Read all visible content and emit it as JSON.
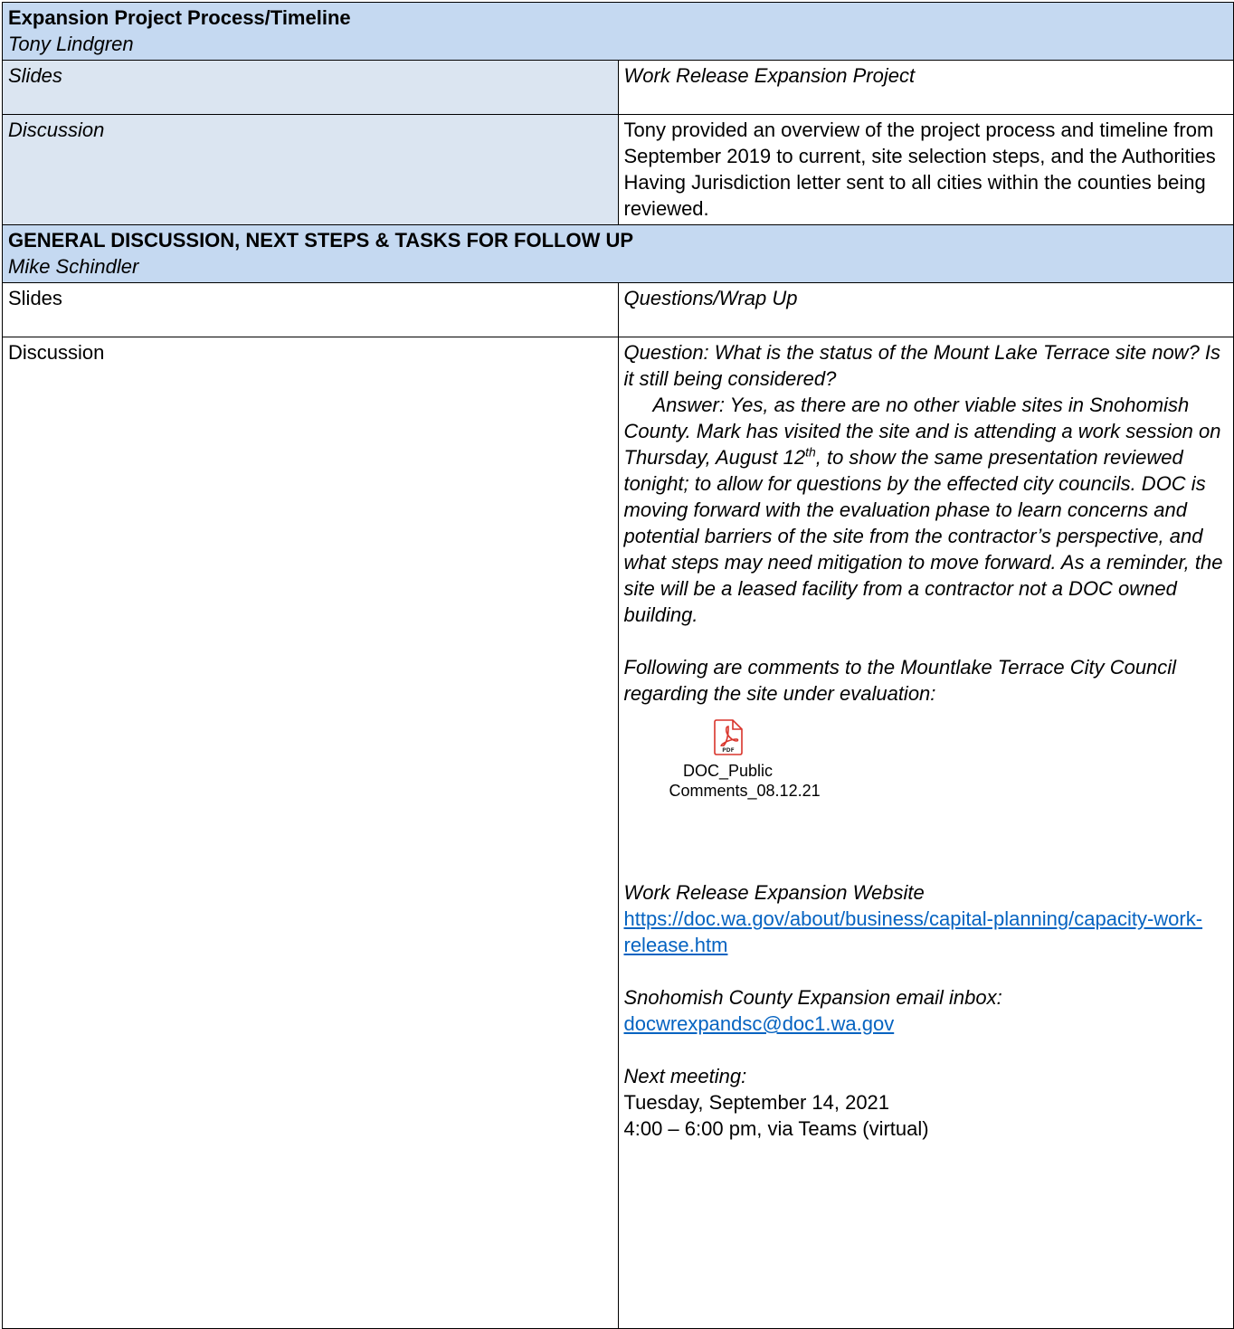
{
  "section1": {
    "title": "Expansion Project Process/Timeline",
    "presenter": "Tony Lindgren",
    "rows": [
      {
        "label": "Slides",
        "text": "Work Release Expansion Project"
      },
      {
        "label": "Discussion",
        "text": "Tony provided an overview of the project process and timeline from September 2019 to current, site selection steps, and the Authorities Having Jurisdiction letter sent to all cities within the counties being reviewed."
      }
    ]
  },
  "section2": {
    "title": "GENERAL DISCUSSION, NEXT STEPS & TASKS FOR FOLLOW UP",
    "presenter": "Mike Schindler",
    "slides_label": "Slides",
    "slides_text": "Questions/Wrap Up",
    "discussion_label": "Discussion",
    "question": "Question:  What is the status of the Mount Lake Terrace site now?  Is it still being considered?",
    "answer_a": "Answer:  Yes, as there are no other viable sites in Snohomish County.  Mark has visited the site and is attending a work session on Thursday, August 12",
    "answer_sup": "th",
    "answer_b": ", to show the same presentation reviewed tonight; to allow for questions by the effected city councils.  DOC is moving forward with the evaluation phase to learn concerns and potential barriers of the site from the contractor’s perspective, and what steps may need mitigation to move forward.  As a reminder, the site will be a leased facility from a contractor not a DOC owned building.",
    "comments_intro": "Following are comments to the Mountlake Terrace City Council regarding the site under evaluation:",
    "attachment": {
      "icon": "pdf-icon",
      "line1": "DOC_Public",
      "line2": "Comments_08.12.21"
    },
    "website_label": "Work Release Expansion Website",
    "website_url": "https://doc.wa.gov/about/business/capital-planning/capacity-work-release.htm",
    "email_label": "Snohomish County Expansion email inbox:",
    "email": "docwrexpandsc@doc1.wa.gov",
    "next_label": "Next meeting:",
    "next_date": "Tuesday, September 14, 2021",
    "next_time": "4:00 – 6:00 pm, via Teams (virtual)"
  }
}
